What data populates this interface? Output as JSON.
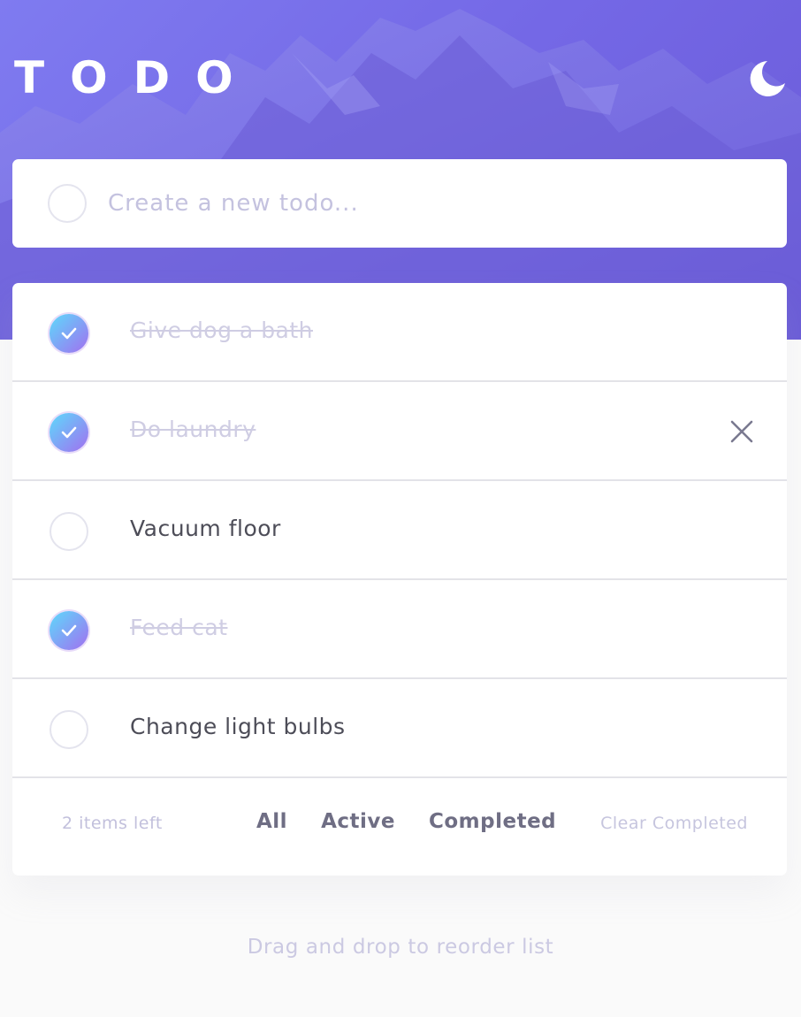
{
  "app": {
    "title": "TODO"
  },
  "theme": {
    "toggle_icon": "moon-icon",
    "accent_gradient": [
      "#57ddff",
      "#c058f3"
    ],
    "header_colors": [
      "#7f7bf0",
      "#6b5bd8"
    ]
  },
  "new_todo": {
    "placeholder": "Create a new todo..."
  },
  "todos": [
    {
      "text": "Give dog a bath",
      "completed": true
    },
    {
      "text": "Do laundry",
      "completed": true
    },
    {
      "text": "Vacuum floor",
      "completed": false
    },
    {
      "text": "Feed cat",
      "completed": true
    },
    {
      "text": "Change light bulbs",
      "completed": false
    }
  ],
  "footer": {
    "items_left": "2 items left",
    "filters": [
      "All",
      "Active",
      "Completed"
    ],
    "clear_label": "Clear Completed"
  },
  "hint": "Drag and drop to reorder list",
  "icons": {
    "check": "check-icon",
    "delete": "close-icon"
  }
}
